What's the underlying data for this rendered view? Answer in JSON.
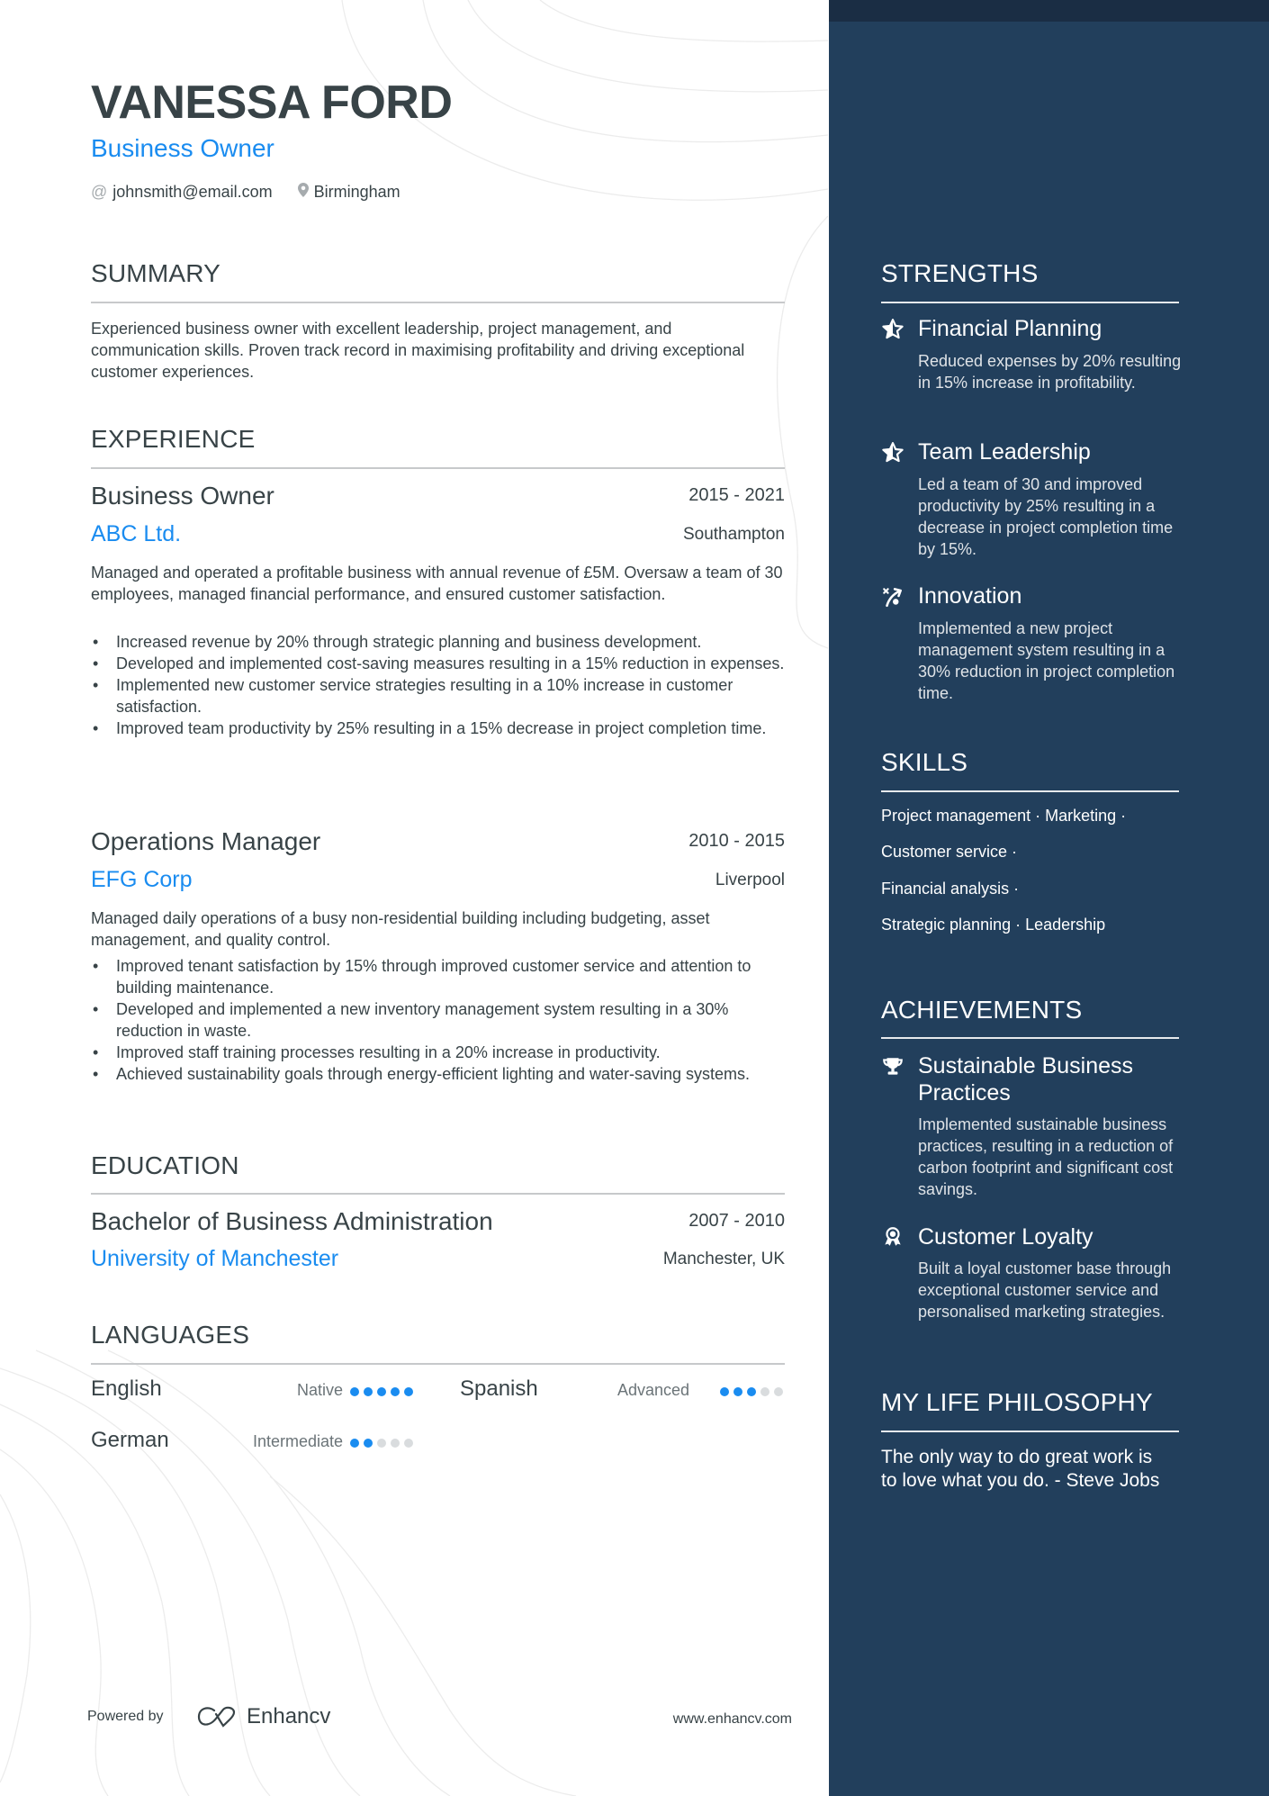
{
  "header": {
    "name": "VANESSA FORD",
    "role": "Business Owner",
    "contact": {
      "email_icon": "at-icon",
      "email": "johnsmith@email.com",
      "location_icon": "map-pin-icon",
      "location": "Birmingham"
    }
  },
  "summary": {
    "title": "SUMMARY",
    "text": "Experienced business owner with excellent leadership, project management, and communication skills. Proven track record in maximising profitability and driving exceptional customer experiences."
  },
  "experience": {
    "title": "EXPERIENCE",
    "jobs": [
      {
        "title": "Business Owner",
        "dates": "2015 - 2021",
        "company": "ABC Ltd.",
        "location": "Southampton",
        "description": "Managed and operated a profitable business with annual revenue of £5M. Oversaw a team of 30 employees, managed financial performance, and ensured customer satisfaction.",
        "bullets": [
          "Increased revenue by 20% through strategic planning and business development.",
          "Developed and implemented cost-saving measures resulting in a 15% reduction in expenses.",
          "Implemented new customer service strategies resulting in a 10% increase in customer satisfaction.",
          "Improved team productivity by 25% resulting in a 15% decrease in project completion time."
        ]
      },
      {
        "title": "Operations Manager",
        "dates": "2010 - 2015",
        "company": "EFG Corp",
        "location": "Liverpool",
        "description": "Managed daily operations of a busy non-residential building including budgeting, asset management, and quality control.",
        "bullets": [
          "Improved tenant satisfaction by 15% through improved customer service and attention to building maintenance.",
          "Developed and implemented a new inventory management system resulting in a 30% reduction in waste.",
          "Improved staff training processes resulting in a 20% increase in productivity.",
          "Achieved sustainability goals through energy-efficient lighting and water-saving systems."
        ]
      }
    ]
  },
  "education": {
    "title": "EDUCATION",
    "items": [
      {
        "degree": "Bachelor of Business Administration",
        "dates": "2007 - 2010",
        "school": "University of Manchester",
        "location": "Manchester, UK"
      }
    ]
  },
  "languages": {
    "title": "LANGUAGES",
    "items": [
      {
        "name": "English",
        "level": "Native",
        "rating": 5,
        "max": 5
      },
      {
        "name": "Spanish",
        "level": "Advanced",
        "rating": 3,
        "max": 5
      },
      {
        "name": "German",
        "level": "Intermediate",
        "rating": 2,
        "max": 5
      }
    ]
  },
  "footer": {
    "powered_by": "Powered by",
    "brand": "Enhancv",
    "url": "www.enhancv.com"
  },
  "sidebar": {
    "strengths": {
      "title": "STRENGTHS",
      "items": [
        {
          "icon": "star-half-icon",
          "title": "Financial Planning",
          "description": "Reduced expenses by 20% resulting in 15% increase in profitability."
        },
        {
          "icon": "star-half-icon",
          "title": "Team Leadership",
          "description": "Led a team of 30 and improved productivity by 25% resulting in a decrease in project completion time by 15%."
        },
        {
          "icon": "strategy-icon",
          "title": "Innovation",
          "description": "Implemented a new project management system resulting in a 30% reduction in project completion time."
        }
      ]
    },
    "skills": {
      "title": "SKILLS",
      "lines": [
        "Project management · Marketing ·",
        "Customer service ·",
        "Financial analysis ·",
        "Strategic planning · Leadership"
      ]
    },
    "achievements": {
      "title": "ACHIEVEMENTS",
      "items": [
        {
          "icon": "trophy-icon",
          "title": "Sustainable Business Practices",
          "description": "Implemented sustainable business practices, resulting in a reduction of carbon footprint and significant cost savings."
        },
        {
          "icon": "medal-icon",
          "title": "Customer Loyalty",
          "description": "Built a loyal customer base through exceptional customer service and personalised marketing strategies."
        }
      ]
    },
    "philosophy": {
      "title": "MY LIFE PHILOSOPHY",
      "quote": "The only way to do great work is to love what you do. - Steve Jobs"
    }
  },
  "colors": {
    "accent": "#1a8cf0",
    "text": "#384347",
    "sidebar": "#223f5c",
    "sidebar_top": "#1a2d44",
    "dot_off": "#d9dcde"
  }
}
